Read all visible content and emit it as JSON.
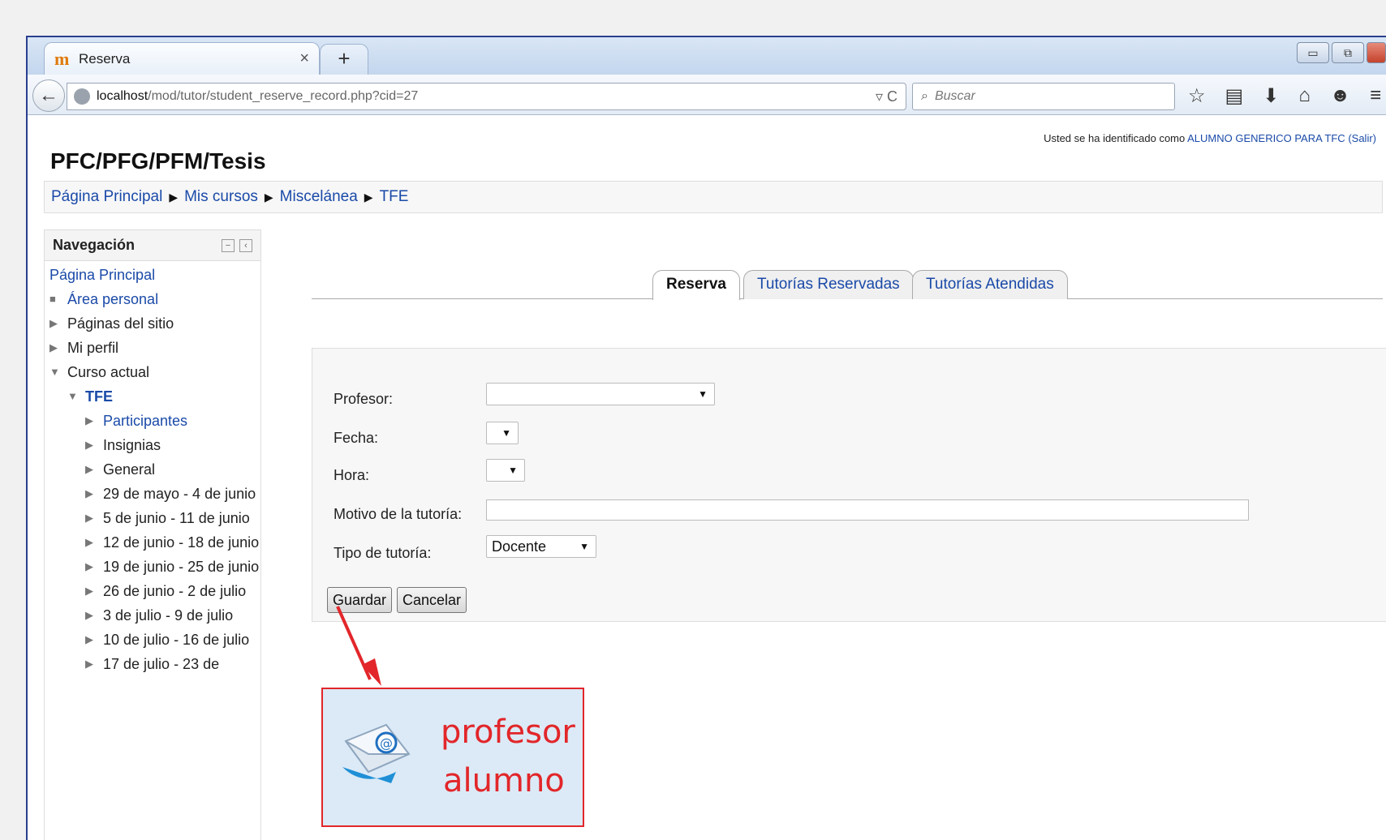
{
  "browser": {
    "tab_title": "Reserva",
    "tab_close": "×",
    "new_tab": "+",
    "url_host": "localhost",
    "url_path": "/mod/tutor/student_reserve_record.php?cid=27",
    "search_placeholder": "Buscar"
  },
  "header": {
    "login_text": "Usted se ha identificado como ",
    "user_name": "ALUMNO GENERICO PARA TFC",
    "logout": "(Salir)",
    "site_title": "PFC/PFG/PFM/Tesis"
  },
  "breadcrumb": [
    "Página Principal",
    "Mis cursos",
    "Miscelánea",
    "TFE"
  ],
  "navigation": {
    "title": "Navegación",
    "items": [
      {
        "label": "Página Principal"
      },
      {
        "label": "Área personal"
      },
      {
        "label": "Páginas del sitio"
      },
      {
        "label": "Mi perfil"
      },
      {
        "label": "Curso actual"
      },
      {
        "label": "TFE"
      },
      {
        "label": "Participantes"
      },
      {
        "label": "Insignias"
      },
      {
        "label": "General"
      },
      {
        "label": "29 de mayo - 4 de junio"
      },
      {
        "label": "5 de junio - 11 de junio"
      },
      {
        "label": "12 de junio - 18 de junio"
      },
      {
        "label": "19 de junio - 25 de junio"
      },
      {
        "label": "26 de junio - 2 de julio"
      },
      {
        "label": "3 de julio - 9 de julio"
      },
      {
        "label": "10 de julio - 16 de julio"
      },
      {
        "label": "17 de julio - 23 de"
      }
    ]
  },
  "tabs": [
    "Reserva",
    "Tutorías Reservadas",
    "Tutorías Atendidas"
  ],
  "form": {
    "profesor_label": "Profesor:",
    "fecha_label": "Fecha:",
    "hora_label": "Hora:",
    "motivo_label": "Motivo de la tutoría:",
    "tipo_label": "Tipo de tutoría:",
    "tipo_value": "Docente",
    "save": "Guardar",
    "cancel": "Cancelar"
  },
  "callout": {
    "line1": "profesor",
    "line2": "alumno"
  },
  "colors": {
    "link": "#1a4aa8",
    "annotation": "#e2262a",
    "callout_bg": "#dbeaf6"
  }
}
